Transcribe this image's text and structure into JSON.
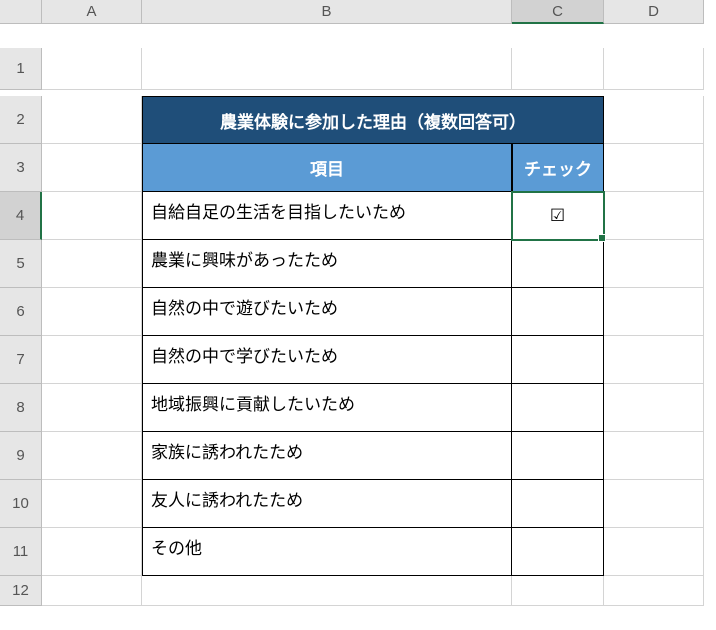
{
  "columns": [
    "A",
    "B",
    "C",
    "D"
  ],
  "rows": [
    "1",
    "2",
    "3",
    "4",
    "5",
    "6",
    "7",
    "8",
    "9",
    "10",
    "11",
    "12"
  ],
  "title": "農業体験に参加した理由（複数回答可）",
  "headers": {
    "item": "項目",
    "check": "チェック"
  },
  "items": [
    {
      "label": "自給自足の生活を目指したいため",
      "check": "☑"
    },
    {
      "label": "農業に興味があったため",
      "check": ""
    },
    {
      "label": "自然の中で遊びたいため",
      "check": ""
    },
    {
      "label": "自然の中で学びたいため",
      "check": ""
    },
    {
      "label": "地域振興に貢献したいため",
      "check": ""
    },
    {
      "label": "家族に誘われたため",
      "check": ""
    },
    {
      "label": "友人に誘われたため",
      "check": ""
    },
    {
      "label": "その他",
      "check": ""
    }
  ],
  "activeCell": "C4",
  "chart_data": {
    "type": "table",
    "title": "農業体験に参加した理由（複数回答可）",
    "columns": [
      "項目",
      "チェック"
    ],
    "rows": [
      [
        "自給自足の生活を目指したいため",
        "☑"
      ],
      [
        "農業に興味があったため",
        ""
      ],
      [
        "自然の中で遊びたいため",
        ""
      ],
      [
        "自然の中で学びたいため",
        ""
      ],
      [
        "地域振興に貢献したいため",
        ""
      ],
      [
        "家族に誘われたため",
        ""
      ],
      [
        "友人に誘われたため",
        ""
      ],
      [
        "その他",
        ""
      ]
    ]
  }
}
